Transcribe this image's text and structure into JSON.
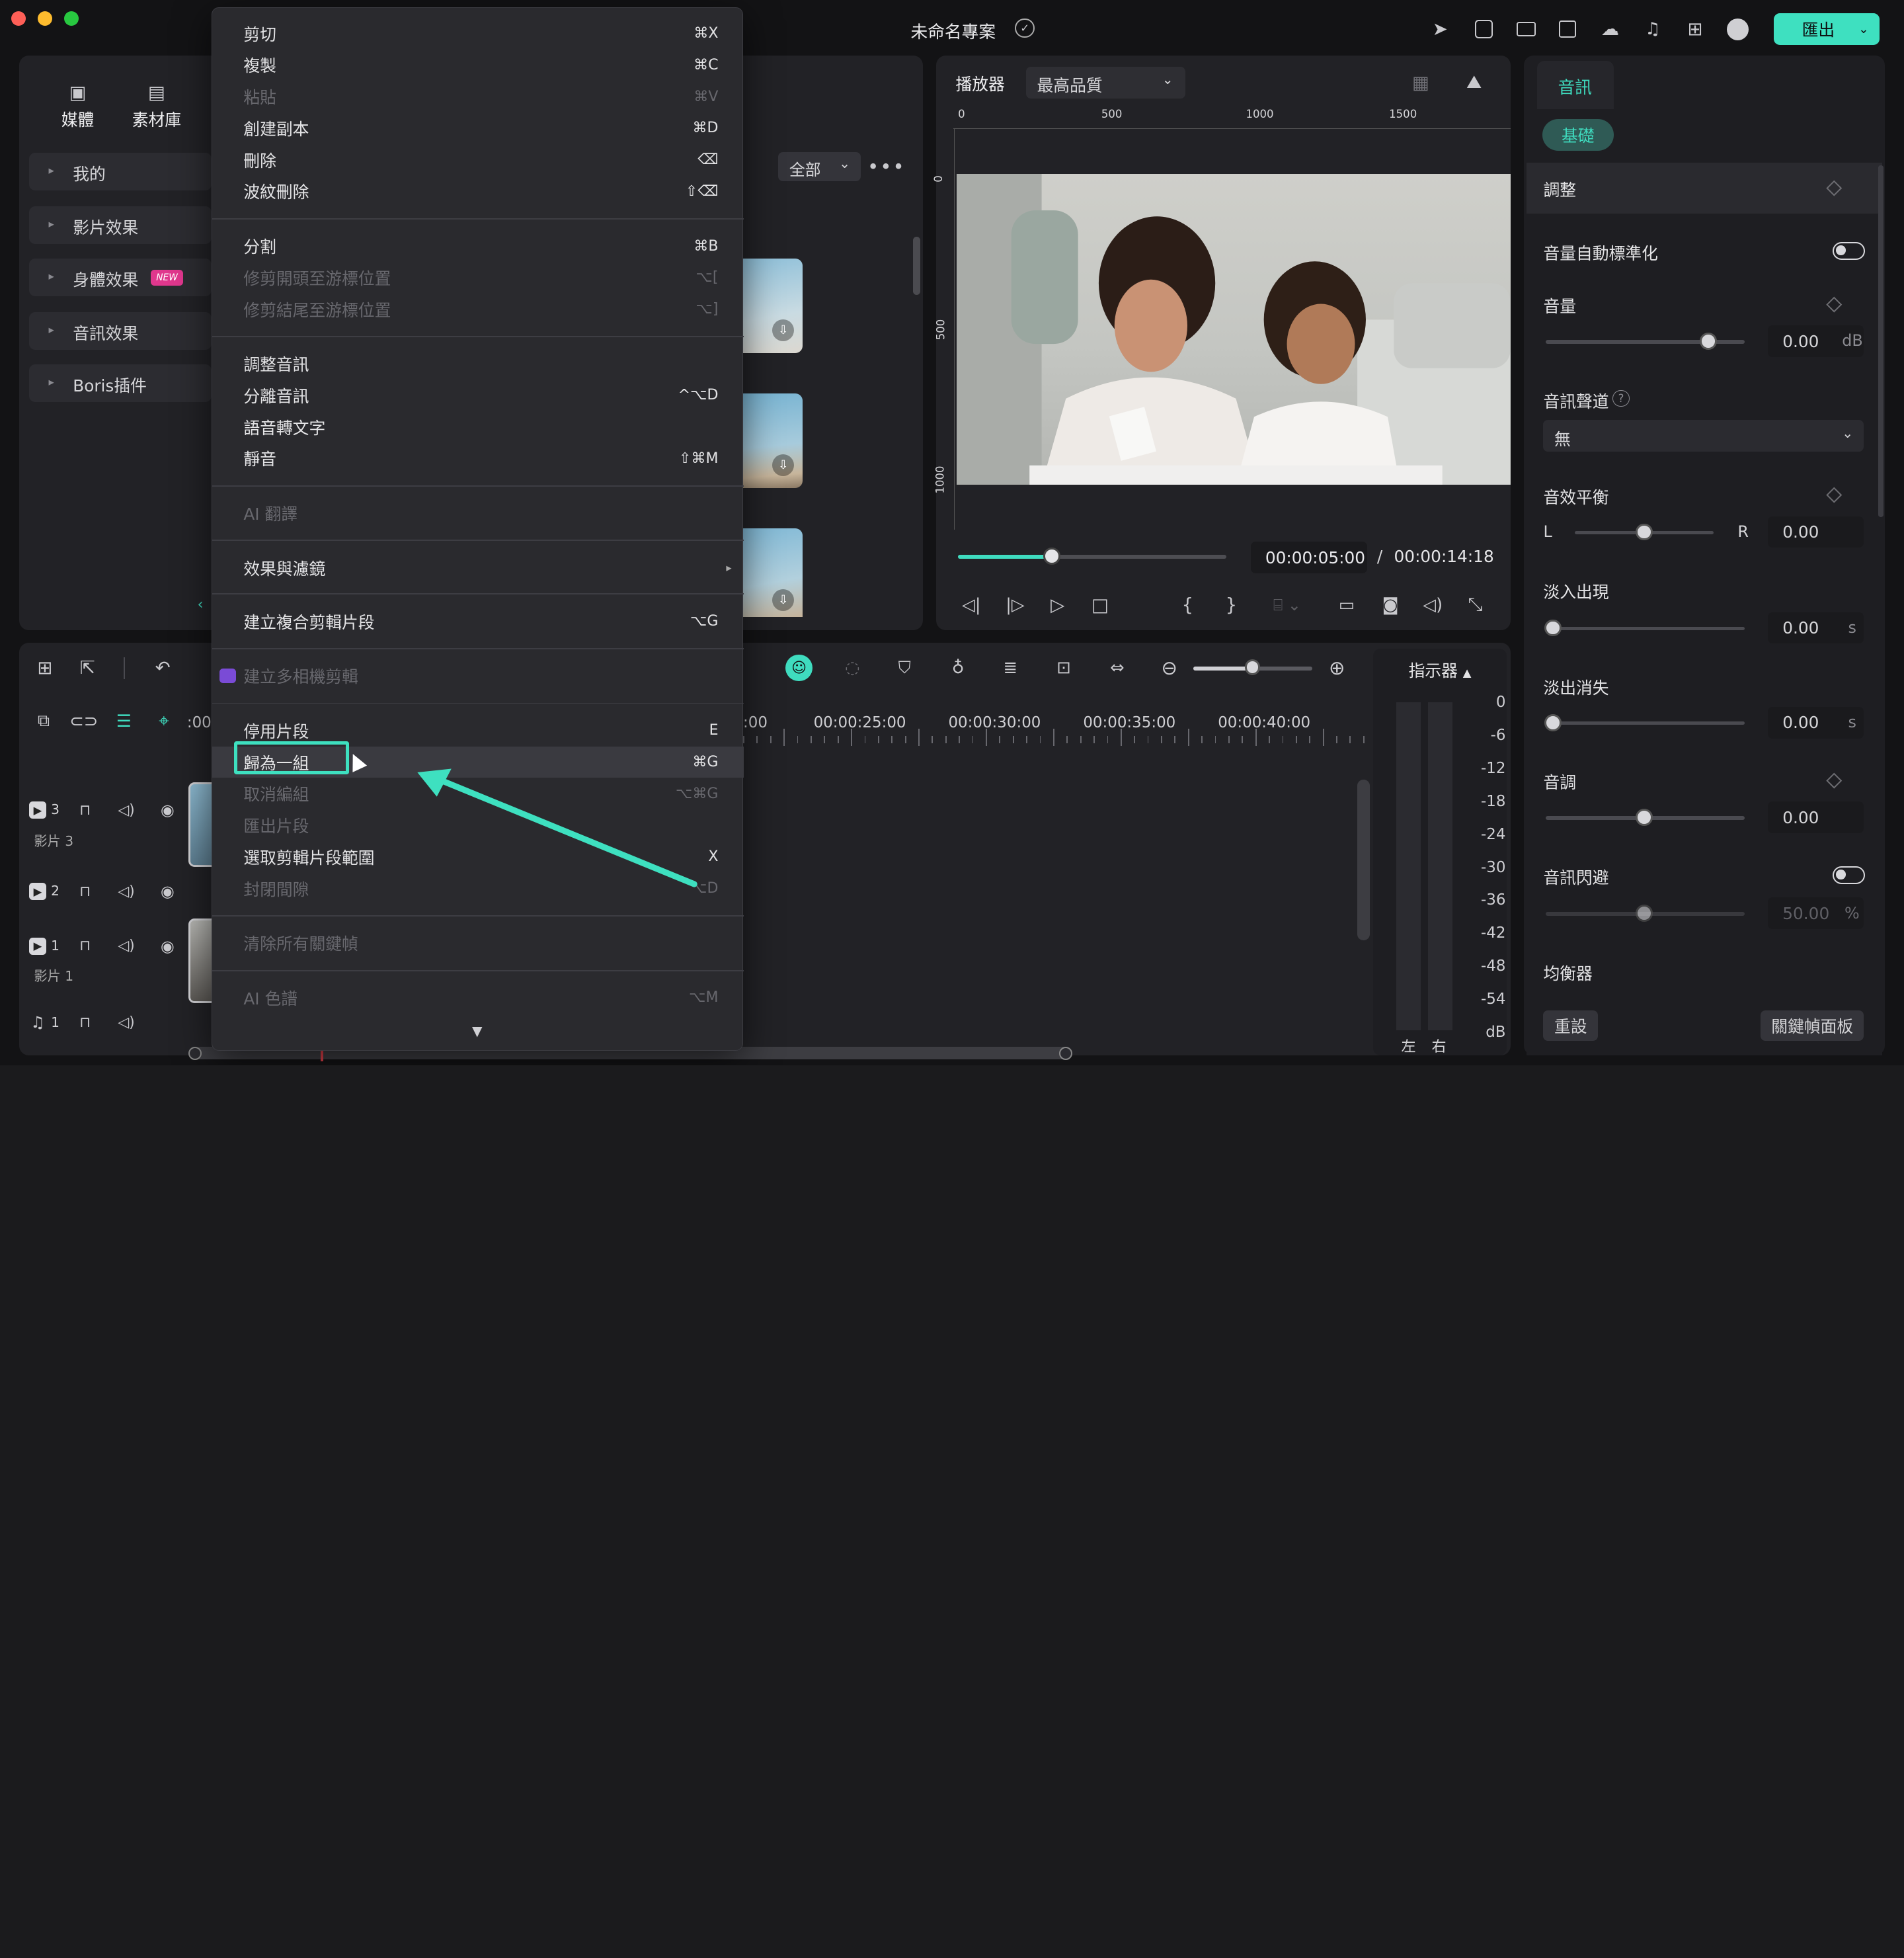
{
  "window": {
    "title": "未命名專案",
    "export_label": "匯出"
  },
  "left_tabs": [
    {
      "label": "媒體",
      "icon": "media-icon"
    },
    {
      "label": "素材庫",
      "icon": "stock-icon"
    }
  ],
  "left_sidebar": [
    {
      "label": "我的"
    },
    {
      "label": "影片效果"
    },
    {
      "label": "身體效果",
      "badge": "NEW"
    },
    {
      "label": "音訊效果"
    },
    {
      "label": "Boris插件"
    }
  ],
  "media_filter": {
    "label": "全部"
  },
  "context_menu": {
    "items": [
      {
        "label": "剪切",
        "shortcut": "⌘X",
        "enabled": true
      },
      {
        "label": "複製",
        "shortcut": "⌘C",
        "enabled": true
      },
      {
        "label": "粘貼",
        "shortcut": "⌘V",
        "enabled": false
      },
      {
        "label": "創建副本",
        "shortcut": "⌘D",
        "enabled": true
      },
      {
        "label": "刪除",
        "shortcut": "⌫",
        "enabled": true
      },
      {
        "label": "波紋刪除",
        "shortcut": "⇧⌫",
        "enabled": true
      },
      {
        "label": "分割",
        "shortcut": "⌘B",
        "enabled": true
      },
      {
        "label": "修剪開頭至游標位置",
        "shortcut": "⌥[",
        "enabled": false
      },
      {
        "label": "修剪結尾至游標位置",
        "shortcut": "⌥]",
        "enabled": false
      },
      {
        "label": "調整音訊",
        "shortcut": "",
        "enabled": true
      },
      {
        "label": "分離音訊",
        "shortcut": "^⌥D",
        "enabled": true
      },
      {
        "label": "語音轉文字",
        "shortcut": "",
        "enabled": true
      },
      {
        "label": "靜音",
        "shortcut": "⇧⌘M",
        "enabled": true
      },
      {
        "label": "AI 翻譯",
        "shortcut": "",
        "enabled": false
      },
      {
        "label": "效果與濾鏡",
        "shortcut": "",
        "enabled": true,
        "submenu": true
      },
      {
        "label": "建立複合剪輯片段",
        "shortcut": "⌥G",
        "enabled": true
      },
      {
        "label": "建立多相機剪輯",
        "shortcut": "",
        "enabled": false
      },
      {
        "label": "停用片段",
        "shortcut": "E",
        "enabled": true
      },
      {
        "label": "歸為一組",
        "shortcut": "⌘G",
        "enabled": true,
        "highlighted": true
      },
      {
        "label": "取消編組",
        "shortcut": "⌥⌘G",
        "enabled": false
      },
      {
        "label": "匯出片段",
        "shortcut": "",
        "enabled": false
      },
      {
        "label": "選取剪輯片段範圍",
        "shortcut": "X",
        "enabled": true
      },
      {
        "label": "封閉間隙",
        "shortcut": "⌥D",
        "enabled": false
      },
      {
        "label": "清除所有關鍵幀",
        "shortcut": "",
        "enabled": false
      },
      {
        "label": "AI 色譜",
        "shortcut": "⌥M",
        "enabled": false
      }
    ]
  },
  "player": {
    "label": "播放器",
    "quality": "最高品質",
    "ruler_h": [
      "0",
      "500",
      "1000",
      "1500"
    ],
    "ruler_v": [
      "0",
      "500",
      "1000"
    ],
    "current_time": "00:00:05:00",
    "separator": "/",
    "total_time": "00:00:14:18",
    "progress": 0.35
  },
  "timeline": {
    "times": [
      "00:00:25:00",
      "00:00:30:00",
      "00:00:35:00",
      "00:00:40:00"
    ],
    "first_time": ":00",
    "first_time_r": ":00",
    "tracks": [
      {
        "num": "3",
        "name": "影片 3"
      },
      {
        "num": "2",
        "name": ""
      },
      {
        "num": "1",
        "name": "影片 1"
      },
      {
        "num": "1",
        "name": ""
      }
    ],
    "meter_label": "指示器",
    "meter_scale": [
      "0",
      "-6",
      "-12",
      "-18",
      "-24",
      "-30",
      "-36",
      "-42",
      "-48",
      "-54",
      "dB"
    ],
    "meter_channels": [
      "左",
      "右"
    ]
  },
  "props": {
    "tab": "音訊",
    "subtab": "基礎",
    "section": "調整",
    "auto_normalize": "音量自動標準化",
    "volume": {
      "label": "音量",
      "value": "0.00",
      "unit": "dB"
    },
    "channel": {
      "label": "音訊聲道",
      "value": "無"
    },
    "balance": {
      "label": "音效平衡",
      "left": "L",
      "right": "R",
      "value": "0.00"
    },
    "fade_in": {
      "label": "淡入出現",
      "value": "0.00",
      "unit": "s"
    },
    "fade_out": {
      "label": "淡出消失",
      "value": "0.00",
      "unit": "s"
    },
    "pitch": {
      "label": "音調",
      "value": "0.00"
    },
    "ducking": {
      "label": "音訊閃避",
      "value": "50.00",
      "unit": "%"
    },
    "equalizer": {
      "label": "均衡器"
    },
    "reset": "重設",
    "keyframe_panel": "關鍵幀面板"
  }
}
